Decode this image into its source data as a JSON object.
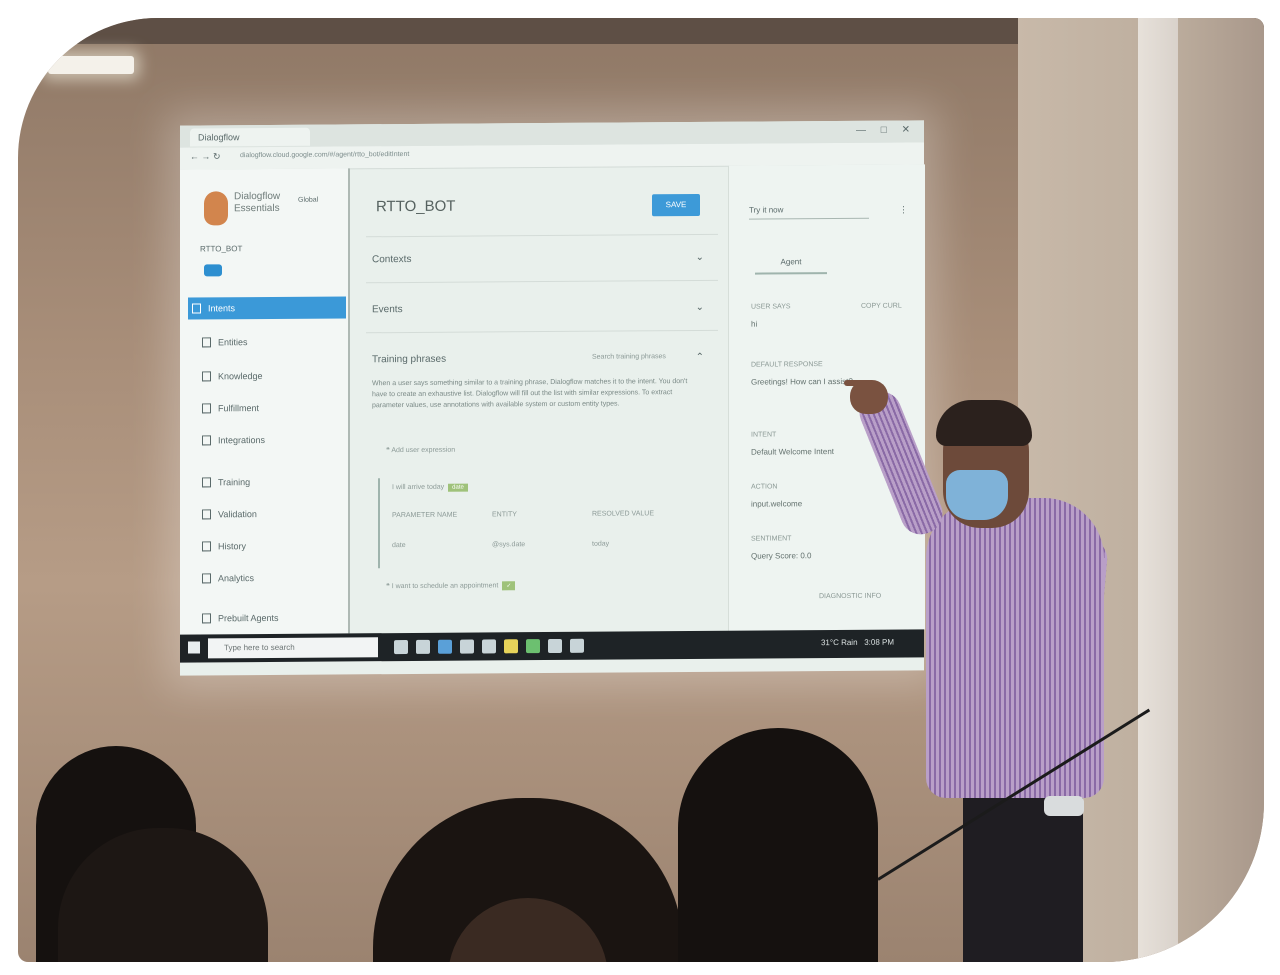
{
  "browser": {
    "tab_title": "Dialogflow",
    "url": "dialogflow.cloud.google.com/#/agent/rtto_bot/editIntent"
  },
  "app": {
    "logo_text": "Dialogflow Essentials",
    "agent_name": "RTTO_BOT",
    "global_label": "Global"
  },
  "sidebar": {
    "items": [
      {
        "label": "Intents",
        "icon": "chat-icon"
      },
      {
        "label": "Entities",
        "icon": "entity-icon"
      },
      {
        "label": "Knowledge",
        "icon": "book-icon"
      },
      {
        "label": "Fulfillment",
        "icon": "bolt-icon"
      },
      {
        "label": "Integrations",
        "icon": "plug-icon"
      },
      {
        "label": "Training",
        "icon": "school-icon"
      },
      {
        "label": "Validation",
        "icon": "check-icon"
      },
      {
        "label": "History",
        "icon": "history-icon"
      },
      {
        "label": "Analytics",
        "icon": "chart-icon"
      },
      {
        "label": "Prebuilt Agents",
        "icon": "agent-icon"
      }
    ]
  },
  "intent": {
    "title": "RTTO_BOT",
    "save_label": "SAVE",
    "sections": [
      {
        "label": "Contexts"
      },
      {
        "label": "Events"
      },
      {
        "label": "Training phrases"
      }
    ],
    "search_placeholder": "Search training phrases",
    "description": "When a user says something similar to a training phrase, Dialogflow matches it to the intent. You don't have to create an exhaustive list. Dialogflow will fill out the list with similar expressions. To extract parameter values, use annotations with available system or custom entity types.",
    "add_phrase": "Add user expression",
    "phrases": [
      "I will arrive today",
      "I want to schedule an appointment"
    ],
    "param_headers": [
      "PARAMETER NAME",
      "ENTITY",
      "RESOLVED VALUE"
    ],
    "param_row": [
      "date",
      "@sys.date",
      "today"
    ]
  },
  "try_panel": {
    "input_placeholder": "Try it now",
    "tab_label": "Agent",
    "user_says_label": "USER SAYS",
    "copy_curl": "COPY CURL",
    "user_says_value": "hi",
    "response_label": "DEFAULT RESPONSE",
    "response_value": "Greetings! How can I assist?",
    "intent_label": "INTENT",
    "intent_value": "Default Welcome Intent",
    "action_label": "ACTION",
    "action_value": "input.welcome",
    "sentiment_label": "SENTIMENT",
    "sentiment_value": "Query Score: 0.0",
    "diagnostic": "DIAGNOSTIC INFO"
  },
  "taskbar": {
    "search_placeholder": "Type here to search",
    "tray_text": "31°C Rain",
    "tray_time": "3:08 PM"
  },
  "colors": {
    "accent": "#3b99d8",
    "wall": "#a88e79",
    "screen": "#e9f0ec",
    "shirt": "#b99fc8"
  }
}
